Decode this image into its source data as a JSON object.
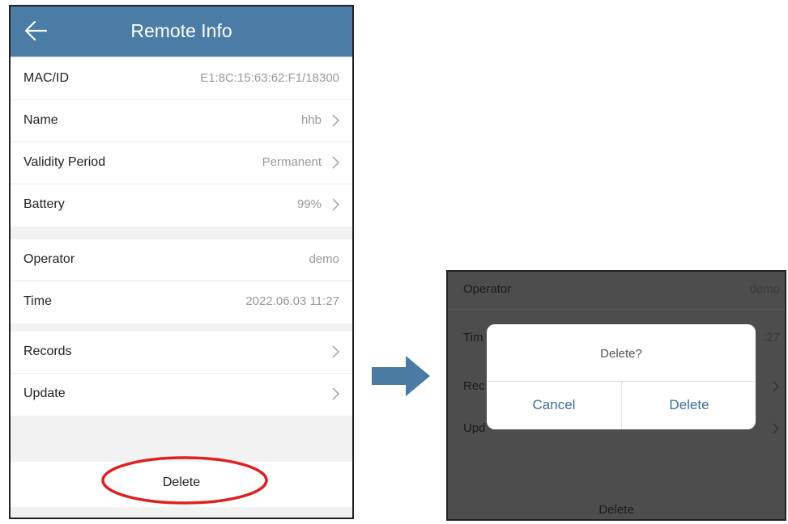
{
  "header": {
    "title": "Remote Info"
  },
  "info": {
    "mac_label": "MAC/ID",
    "mac_value": "E1:8C:15:63:62:F1/18300",
    "name_label": "Name",
    "name_value": "hhb",
    "validity_label": "Validity Period",
    "validity_value": "Permanent",
    "battery_label": "Battery",
    "battery_value": "99%"
  },
  "meta": {
    "operator_label": "Operator",
    "operator_value": "demo",
    "time_label": "Time",
    "time_value": "2022.06.03 11:27"
  },
  "actions": {
    "records_label": "Records",
    "update_label": "Update"
  },
  "delete_label": "Delete",
  "dimmed": {
    "operator_label": "Operator",
    "operator_value": "demo",
    "time_label_partial": "Tim",
    "time_value_partial": ":27",
    "records_label_partial": "Rec",
    "update_label_partial": "Upd",
    "delete_label": "Delete"
  },
  "dialog": {
    "message": "Delete?",
    "cancel_label": "Cancel",
    "confirm_label": "Delete"
  },
  "colors": {
    "appbar": "#4a7ca5",
    "highlight": "#e02020",
    "arrow": "#4b7aa3",
    "dialog_button": "#3f6f97"
  },
  "icons": {
    "back": "arrow-left-icon",
    "chevron": "chevron-right-icon",
    "flow_arrow": "flow-arrow-icon"
  }
}
